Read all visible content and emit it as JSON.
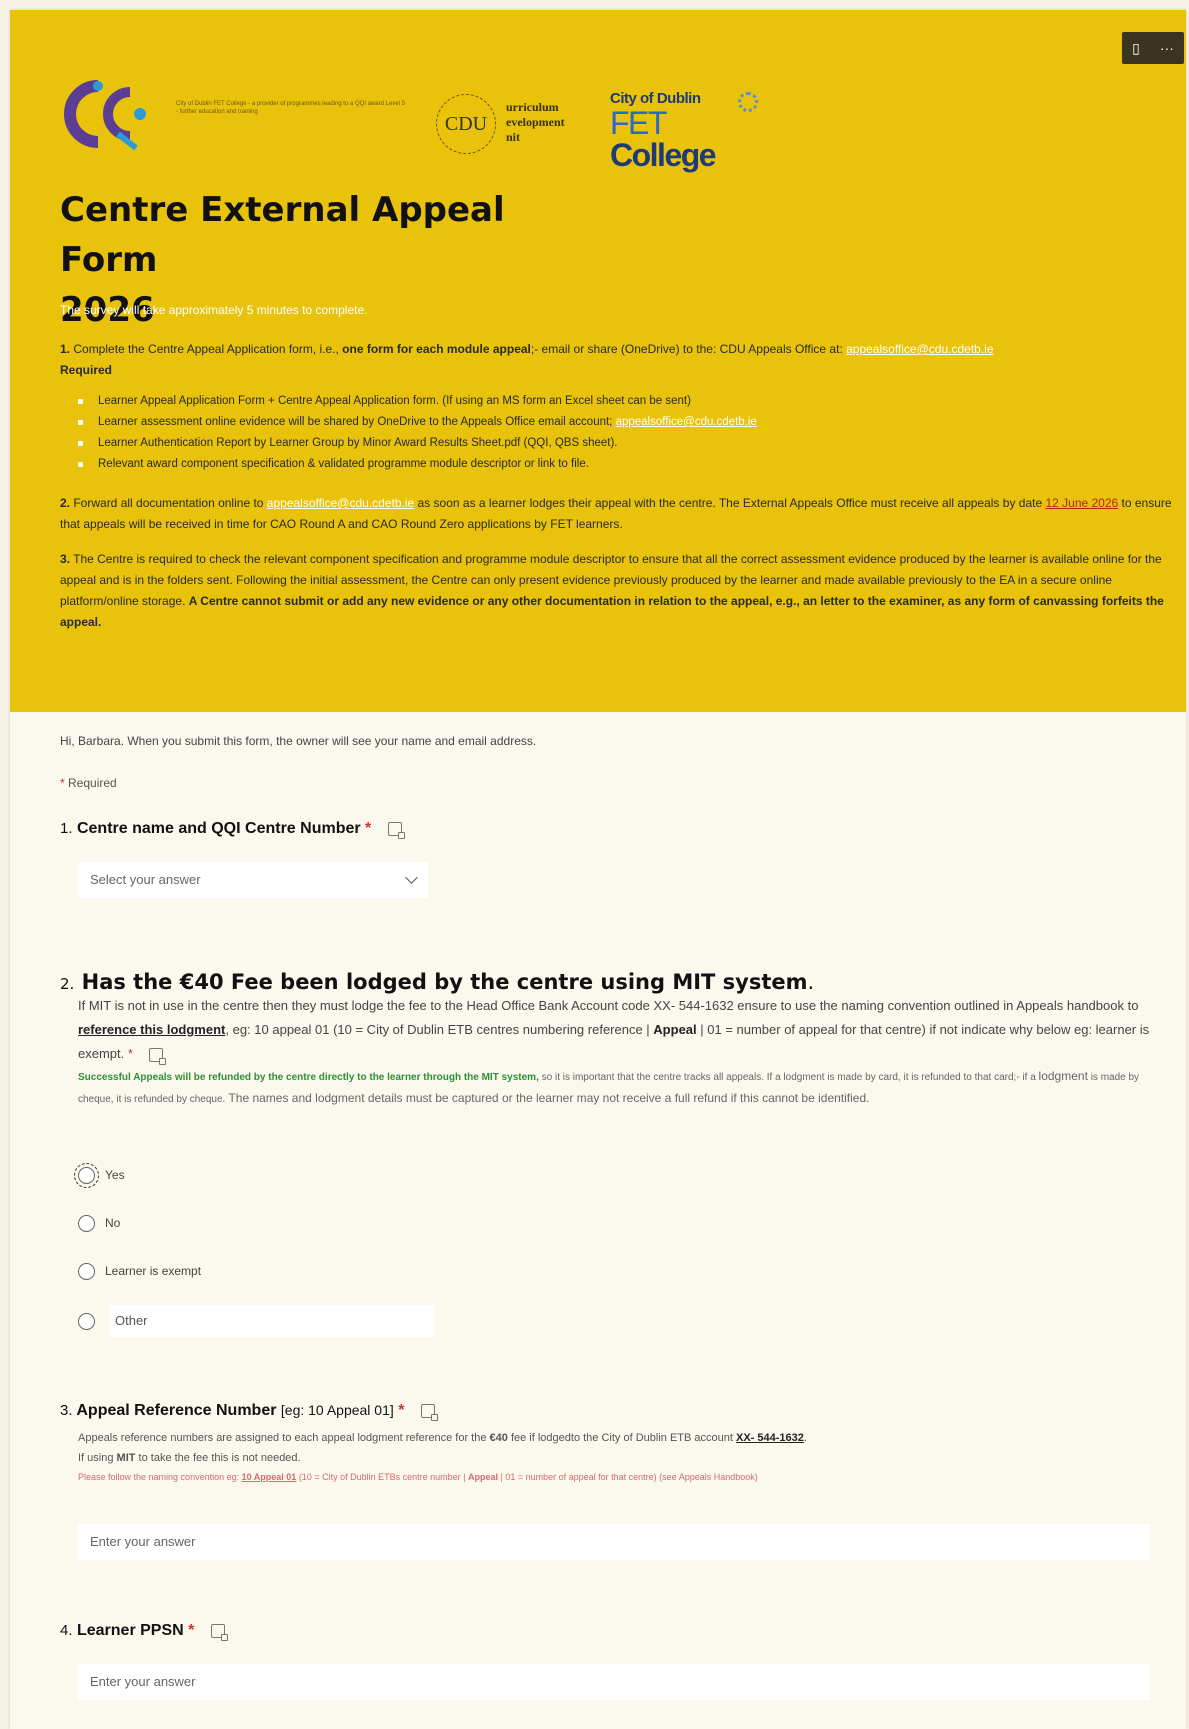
{
  "header": {
    "title_line1": "Centre External Appeal Form",
    "title_line2": "2026",
    "qqi_text": "City of Dublin FET College - a provider of programmes leading to a QQI award Level 5 - further education and training",
    "cdu_seal": "CDU",
    "cdu_text": [
      "urriculum",
      "evelopment",
      "nit"
    ],
    "fet_top": "City of Dublin",
    "fet_prefix": "FET",
    "fet_bottom": "College",
    "survey_time": "The survey will take approximately 5 minutes to complete.",
    "p1_prefix": "1.",
    "p1_text": " Complete the Centre Appeal Application form, i.e., ",
    "p1_bold": "one form for each module appeal",
    "p1_rest": ";- email or share (OneDrive) to the: CDU Appeals Office at: ",
    "email": "appealsoffice@cdu.cdetb.ie",
    "required_label": "Required",
    "bullets": [
      "Learner Appeal Application Form + Centre Appeal Application form. (If using an MS form an Excel sheet can be sent)",
      "Learner assessment online evidence will be shared by OneDrive to the Appeals Office email account; ",
      "Learner Authentication Report by Learner Group by Minor Award Results Sheet.pdf (QQI, QBS sheet).",
      "Relevant award component specification & validated programme module descriptor or link to file."
    ],
    "bullet2_email": "appealsoffice@cdu.cdetb.ie",
    "p2_prefix": "2.",
    "p2_text": " Forward all documentation online to ",
    "p2_email": "appealsoffice@cdu.cdetb.ie",
    "p2_rest": " as soon as a learner lodges their appeal with the centre.  The External Appeals Office must receive all appeals by date ",
    "p2_date": "12 June 2026",
    "p2_end": " to ensure that appeals will be received in time for CAO Round A and CAO Round Zero applications by FET learners.",
    "p3_prefix": "3.",
    "p3_text": " The Centre is required to check the relevant component specification and programme module descriptor to ensure that all the correct assessment evidence produced by the learner is available online for the appeal and is in the folders sent. Following the initial assessment, the Centre can only present evidence previously produced by the learner and made available previously to the EA in a secure online platform/online storage.  ",
    "p3_bold": "A Centre cannot submit or add any new evidence or any other documentation in relation to the appeal, e.g., an letter to the examiner, as any form of canvassing forfeits the appeal."
  },
  "toolbar": {
    "icon": "book-icon",
    "more": "···"
  },
  "greeting": "Hi, Barbara. When you submit this form, the owner will see your name and email address.",
  "required_note": "Required",
  "q1": {
    "num": "1.",
    "title": "Centre name and QQI Centre Number",
    "placeholder": "Select your answer"
  },
  "q2": {
    "num": "2.",
    "title": "Has the €40 Fee been lodged by the centre using MIT system",
    "desc_a": "If MIT is not in use in the centre then they must lodge the fee to the Head Office Bank Account code XX- 544-1632 ensure to use the naming convention outlined in Appeals handbook to ",
    "desc_link": "reference this lodgment",
    "desc_b": ", eg: 10 appeal 01 (10 = City of Dublin ETB centres numbering reference | ",
    "desc_bold": "Appeal",
    "desc_c": " | 01 = number of appeal for that centre) if not indicate why below eg: learner is exempt. ",
    "small_green": "Successful Appeals will be refunded by the centre directly to the learner through the MIT system,",
    "small_a": " so it is important that the centre tracks all appeals. If a lodgment is made by card, it is refunded to that card;- if a ",
    "small_lodg": "lodgment",
    "small_b": " is made by cheque, it is refunded by cheque.",
    "small_c": " The names and lodgment details must be captured or the learner may not receive a full refund if this cannot be identified.",
    "options": [
      "Yes",
      "No",
      "Learner is exempt",
      "Other"
    ]
  },
  "q3": {
    "num": "3.",
    "title": "Appeal Reference Number",
    "hint": "[eg: 10 Appeal 01]",
    "desc_a": "Appeals reference numbers are assigned to each appeal lodgment reference for the ",
    "desc_fee": "€40",
    "desc_b": " fee if lodgedto the City of Dublin ETB account ",
    "desc_acct": "XX- 544-1632",
    "desc_c": ".",
    "desc_d1": "If using ",
    "desc_mit": "MIT",
    "desc_d2": " to take the fee this is not needed.",
    "red_a": "Please follow the naming convention eg: ",
    "red_link": "10 Appeal 01",
    "red_b": " (10 = City of Dublin ETBs centre number | ",
    "red_bold": "Appeal",
    "red_c": " | 01 = number of appeal for that centre) (see Appeals Handbook)",
    "placeholder": "Enter your answer"
  },
  "q4": {
    "num": "4.",
    "title": "Learner PPSN",
    "placeholder": "Enter your answer"
  },
  "colors": {
    "header_bg": "#e9c20b",
    "accent_red": "#c0392b",
    "green": "#2f8f37"
  }
}
